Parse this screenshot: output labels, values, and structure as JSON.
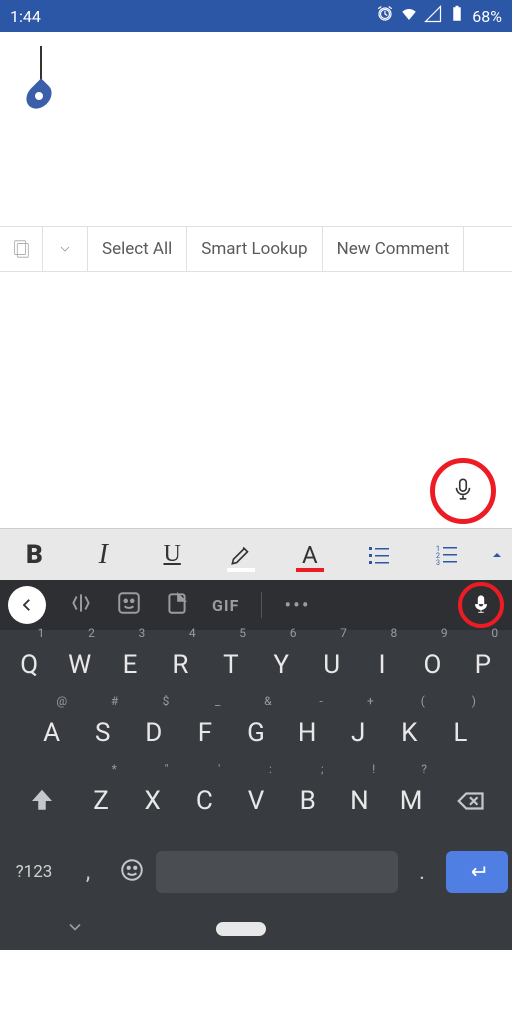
{
  "status": {
    "time": "1:44",
    "battery": "68%"
  },
  "context": {
    "select_all": "Select All",
    "smart_lookup": "Smart Lookup",
    "new_comment": "New Comment"
  },
  "format": {
    "bold": "B",
    "italic": "I",
    "underline": "U",
    "fontcolor": "A"
  },
  "kbtop": {
    "gif": "GIF",
    "dots": "•••"
  },
  "keys": {
    "r1": [
      {
        "l": "Q",
        "s": "1"
      },
      {
        "l": "W",
        "s": "2"
      },
      {
        "l": "E",
        "s": "3"
      },
      {
        "l": "R",
        "s": "4"
      },
      {
        "l": "T",
        "s": "5"
      },
      {
        "l": "Y",
        "s": "6"
      },
      {
        "l": "U",
        "s": "7"
      },
      {
        "l": "I",
        "s": "8"
      },
      {
        "l": "O",
        "s": "9"
      },
      {
        "l": "P",
        "s": "0"
      }
    ],
    "r2": [
      {
        "l": "A",
        "s": "@"
      },
      {
        "l": "S",
        "s": "#"
      },
      {
        "l": "D",
        "s": "$"
      },
      {
        "l": "F",
        "s": "_"
      },
      {
        "l": "G",
        "s": "&"
      },
      {
        "l": "H",
        "s": "-"
      },
      {
        "l": "J",
        "s": "+"
      },
      {
        "l": "K",
        "s": "("
      },
      {
        "l": "L",
        "s": ")"
      }
    ],
    "r3": [
      {
        "l": "Z",
        "s": "*"
      },
      {
        "l": "X",
        "s": "\""
      },
      {
        "l": "C",
        "s": "'"
      },
      {
        "l": "V",
        "s": ":"
      },
      {
        "l": "B",
        "s": ";"
      },
      {
        "l": "N",
        "s": "!"
      },
      {
        "l": "M",
        "s": "?"
      }
    ]
  },
  "bottom": {
    "sym": "?123",
    "comma": ",",
    "period": "."
  }
}
